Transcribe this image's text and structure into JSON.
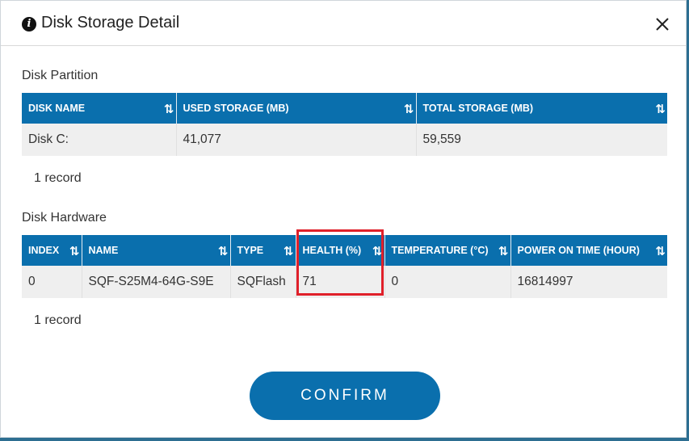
{
  "dialog": {
    "title": "Disk Storage Detail",
    "icon": "info-icon",
    "close_icon": "close-icon"
  },
  "partition": {
    "section_title": "Disk Partition",
    "columns": [
      "DISK NAME",
      "USED STORAGE (MB)",
      "TOTAL STORAGE (MB)"
    ],
    "rows": [
      [
        "Disk C:",
        "41,077",
        "59,559"
      ]
    ],
    "record_count": "1 record"
  },
  "hardware": {
    "section_title": "Disk Hardware",
    "columns": [
      "INDEX",
      "NAME",
      "TYPE",
      "HEALTH (%)",
      "TEMPERATURE (°C)",
      "POWER ON TIME (HOUR)"
    ],
    "rows": [
      [
        "0",
        "SQF-S25M4-64G-S9E",
        "SQFlash",
        "71",
        "0",
        "16814997"
      ]
    ],
    "record_count": "1 record"
  },
  "sort_icon": "⇅",
  "confirm_label": "CONFIRM",
  "colors": {
    "header_bg": "#0a6fad",
    "button_bg": "#0a6fad",
    "highlight": "#e0202a",
    "row_bg": "#efefef"
  }
}
